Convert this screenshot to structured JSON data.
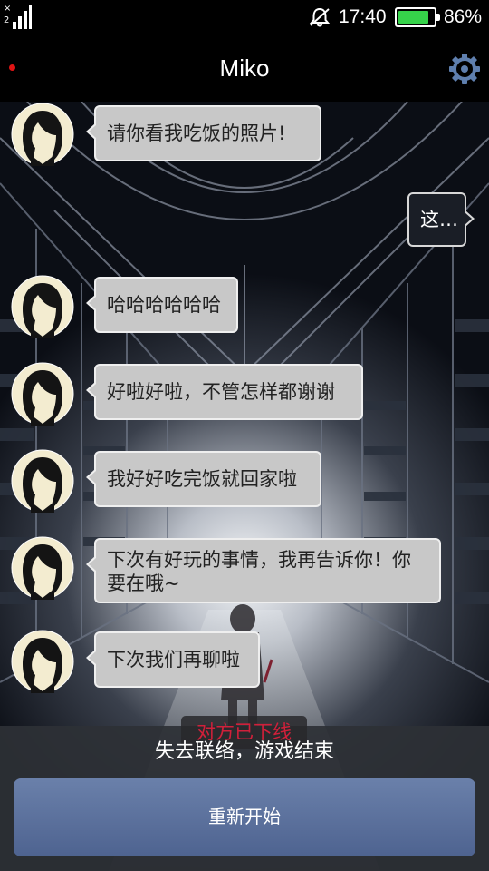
{
  "status_bar": {
    "signal_top": "×",
    "signal_sub": "2",
    "time": "17:40",
    "battery_percent": "86%",
    "battery_level": 0.86,
    "battery_color": "#36d24a"
  },
  "header": {
    "title": "Miko",
    "settings_icon": "gear-icon",
    "unread_dot_color": "#e01414"
  },
  "messages": [
    {
      "sender": "miko",
      "text": "请你看我吃饭的照片!"
    },
    {
      "sender": "me",
      "text": "这…"
    },
    {
      "sender": "miko",
      "text": "哈哈哈哈哈哈"
    },
    {
      "sender": "miko",
      "text": "好啦好啦，不管怎样都谢谢"
    },
    {
      "sender": "miko",
      "text": "我好好吃完饭就回家啦"
    },
    {
      "sender": "miko",
      "text": "下次有好玩的事情，我再告诉你！你要在哦~"
    },
    {
      "sender": "miko",
      "text": "下次我们再聊啦"
    }
  ],
  "footer": {
    "offline_notice": "对方已下线",
    "game_over_text": "失去联络，游戏结束",
    "restart_label": "重新开始",
    "accent_color": "#5a6f9c"
  }
}
